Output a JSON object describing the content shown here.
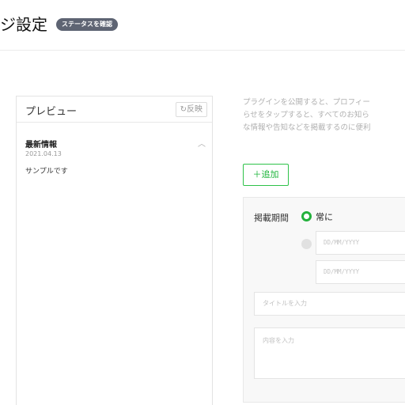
{
  "header": {
    "title": "ジ設定",
    "status_badge": "ステータスを確認"
  },
  "preview": {
    "title": "プレビュー",
    "reflect_label": "反映",
    "reflect_icon": "refresh-icon",
    "news": {
      "title": "最新情報",
      "date": "2021.04.13",
      "body": "サンプルです"
    }
  },
  "description": {
    "lines": [
      "プラグインを公開すると、プロフィー",
      "らせをタップすると、すべてのお知ら",
      "な情報や告知などを掲載するのに便利"
    ]
  },
  "add_button": {
    "label": "＋追加"
  },
  "form": {
    "period_label": "掲載期間",
    "option_always": "常に",
    "start_date_placeholder": "DD/MM/YYYY",
    "end_date_placeholder": "DD/MM/YYYY",
    "title_placeholder": "タイトルを入力",
    "content_placeholder": "内容を入力"
  },
  "colors": {
    "accent_green": "#23b13c",
    "badge_bg": "#5e6473"
  }
}
